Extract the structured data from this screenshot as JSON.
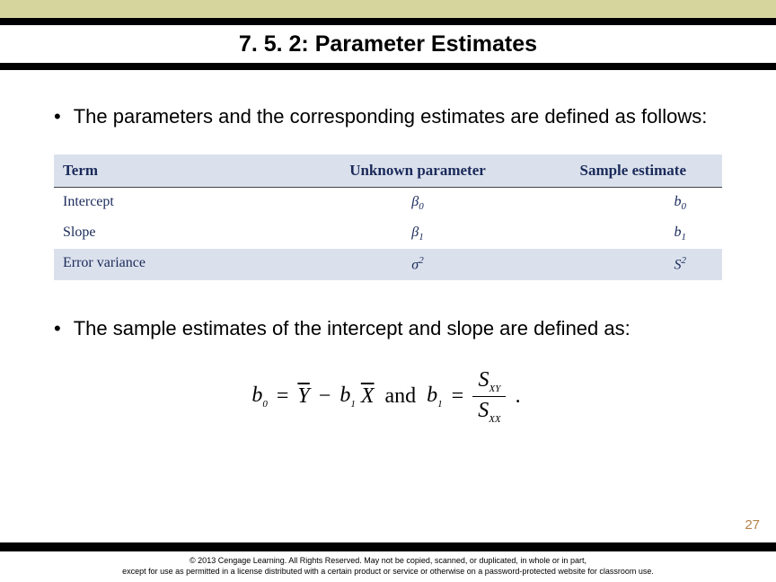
{
  "header": {
    "title": "7. 5. 2: Parameter Estimates"
  },
  "bullets": {
    "b1": "The parameters and the corresponding estimates are defined as follows:",
    "b2": "The sample estimates of the intercept and slope are defined as:"
  },
  "table": {
    "headers": {
      "c1": "Term",
      "c2": "Unknown parameter",
      "c3": "Sample estimate"
    },
    "rows": [
      {
        "term": "Intercept",
        "param": "β",
        "param_sub": "0",
        "est": "b",
        "est_sub": "0"
      },
      {
        "term": "Slope",
        "param": "β",
        "param_sub": "1",
        "est": "b",
        "est_sub": "1"
      },
      {
        "term": "Error variance",
        "param": "σ",
        "param_sup": "2",
        "est": "S",
        "est_sup": "2"
      }
    ]
  },
  "formula": {
    "b0": "b",
    "b0sub": "0",
    "eq": "=",
    "Ybar": "Y",
    "minus": "−",
    "b1": "b",
    "b1sub": "1",
    "Xbar": "X",
    "and": "and",
    "Sxy_top": "S",
    "Sxy_top_sub": "XY",
    "Sxx_bot": "S",
    "Sxx_bot_sub": "XX",
    "dot": "."
  },
  "pagenum": "27",
  "footer": {
    "line1": "© 2013 Cengage Learning. All Rights Reserved. May not be copied, scanned, or duplicated, in whole or in part,",
    "line2": "except for use as permitted in a license distributed with a certain product or service or otherwise on a password-protected website for classroom use."
  }
}
